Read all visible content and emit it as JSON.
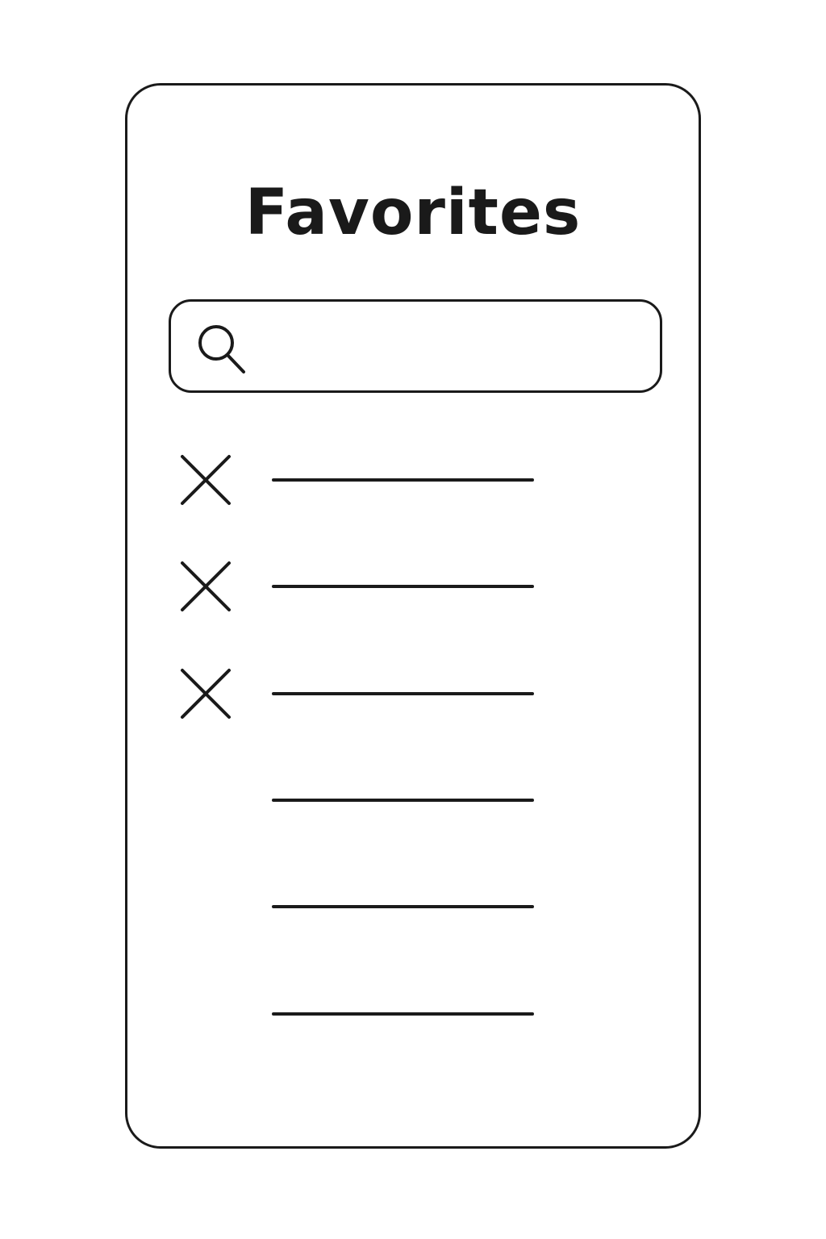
{
  "page": {
    "title": "Favorites"
  },
  "search": {
    "value": "",
    "placeholder": "",
    "icon": "search-icon"
  },
  "favorites": {
    "items": [
      {
        "removable": true,
        "remove_icon": "close-icon"
      },
      {
        "removable": true,
        "remove_icon": "close-icon"
      },
      {
        "removable": true,
        "remove_icon": "close-icon"
      },
      {
        "removable": false
      },
      {
        "removable": false
      },
      {
        "removable": false
      }
    ]
  },
  "colors": {
    "stroke": "#1a1a1a",
    "background": "#ffffff"
  }
}
